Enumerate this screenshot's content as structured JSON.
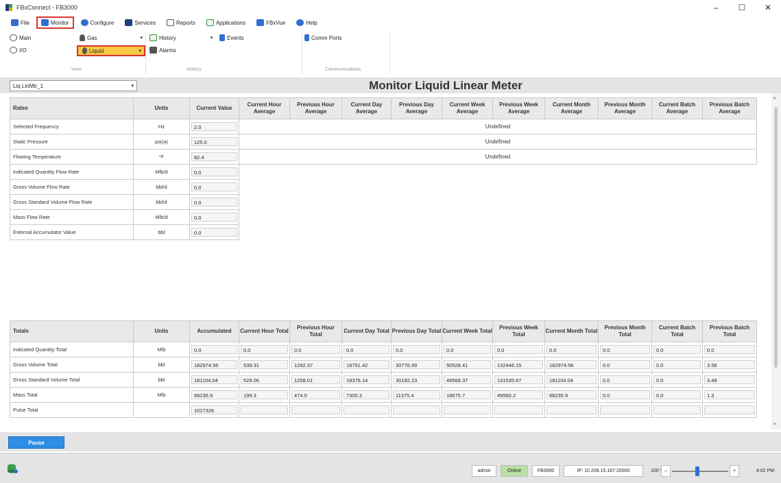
{
  "window": {
    "title": "FBxConnect - FB3000",
    "minimize": "–",
    "maximize": "☐",
    "close": "✕"
  },
  "menu": {
    "items": [
      {
        "label": "File",
        "icon": "folder-icon"
      },
      {
        "label": "Monitor",
        "icon": "monitor-icon"
      },
      {
        "label": "Configure",
        "icon": "configure-icon"
      },
      {
        "label": "Services",
        "icon": "services-icon"
      },
      {
        "label": "Reports",
        "icon": "reports-icon"
      },
      {
        "label": "Applications",
        "icon": "applications-icon"
      },
      {
        "label": "FBxVue",
        "icon": "fbxvue-icon"
      },
      {
        "label": "Help",
        "icon": "help-icon"
      }
    ]
  },
  "ribbon": {
    "main": "Main",
    "io": "I/O",
    "gas": "Gas",
    "liquid": "Liquid",
    "history": "History",
    "alarms": "Alarms",
    "events": "Events",
    "comm_ports": "Comm Ports",
    "group_view": "View",
    "group_history": "History",
    "group_communications": "Communications"
  },
  "header": {
    "meter_select": "Liq LinMtr_1",
    "title": "Monitor Liquid Linear Meter"
  },
  "rates": {
    "headers": [
      "Rates",
      "Units",
      "Current Value"
    ],
    "avg_headers": [
      "Current Hour Average",
      "Previous Hour Average",
      "Current Day Average",
      "Previous Day Average",
      "Current Week Average",
      "Previous Week Average",
      "Current Month Average",
      "Previous Month Average",
      "Current Batch Average",
      "Previous Batch Average"
    ],
    "rows": [
      {
        "name": "Selected Frequency",
        "unit": "Hz",
        "value": "2.0",
        "avg": "Undefined"
      },
      {
        "name": "Static Pressure",
        "unit": "psi(a)",
        "value": "125.0",
        "avg": "Undefined"
      },
      {
        "name": "Flowing Temperature",
        "unit": "°F",
        "value": "82.4",
        "avg": "Undefined"
      },
      {
        "name": "Indicated Quantity Flow Rate",
        "unit": "Mlb/d",
        "value": "0.0",
        "avg": ""
      },
      {
        "name": "Gross Volume Flow Rate",
        "unit": "bbl/d",
        "value": "0.0",
        "avg": ""
      },
      {
        "name": "Gross Standard Volume Flow Rate",
        "unit": "bbl/d",
        "value": "0.0",
        "avg": ""
      },
      {
        "name": "Mass Flow Rate",
        "unit": "Mlb/d",
        "value": "0.0",
        "avg": ""
      },
      {
        "name": "External Accumulator Value",
        "unit": "bbl",
        "value": "0.0",
        "avg": ""
      }
    ]
  },
  "totals": {
    "headers": [
      "Totals",
      "Units",
      "Accumulated",
      "Current Hour Total",
      "Previous Hour Total",
      "Current Day Total",
      "Previous Day Total",
      "Current Week Total",
      "Previous Week Total",
      "Current Month Total",
      "Previous Month Total",
      "Current Batch Total",
      "Previous Batch Total"
    ],
    "rows": [
      {
        "name": "Indicated Quantity Total",
        "unit": "Mlb",
        "values": [
          "0.0",
          "0.0",
          "0.0",
          "0.0",
          "0.0",
          "0.0",
          "0.0",
          "0.0",
          "0.0",
          "0.0",
          "0.0"
        ]
      },
      {
        "name": "Gross Volume Total",
        "unit": "bbl",
        "values": [
          "182974.56",
          "539.31",
          "1282.37",
          "19751.42",
          "30776.99",
          "50528.41",
          "132446.15",
          "182974.56",
          "0.0",
          "0.0",
          "3.56"
        ]
      },
      {
        "name": "Gross Standard Volume Total",
        "unit": "bbl",
        "values": [
          "181104.04",
          "529.06",
          "1258.01",
          "19376.14",
          "30192.23",
          "49568.37",
          "131535.67",
          "181104.04",
          "0.0",
          "0.0",
          "3.49"
        ]
      },
      {
        "name": "Mass Total",
        "unit": "Mlb",
        "values": [
          "68235.9",
          "199.3",
          "474.0",
          "7300.3",
          "11375.4",
          "18675.7",
          "49560.2",
          "68235.9",
          "0.0",
          "0.0",
          "1.3"
        ]
      },
      {
        "name": "Pulse Total",
        "unit": "",
        "values": [
          "1027326",
          "",
          "",
          "",
          "",
          "",
          "",
          "",
          "",
          "",
          ""
        ]
      }
    ]
  },
  "controls": {
    "pause": "Pause"
  },
  "status": {
    "user": "admin",
    "connection": "Online",
    "device": "FB3000",
    "ip": "IP: 10.208.15.167:20000",
    "zoom": "100 %",
    "zoom_minus": "–",
    "zoom_plus": "+",
    "time": "4:02 PM"
  },
  "colors": {
    "highlight_border": "#d9342b",
    "liquid_fill": "#f6c843",
    "pause_button": "#2f8de4",
    "online": "#b9e0a5"
  }
}
